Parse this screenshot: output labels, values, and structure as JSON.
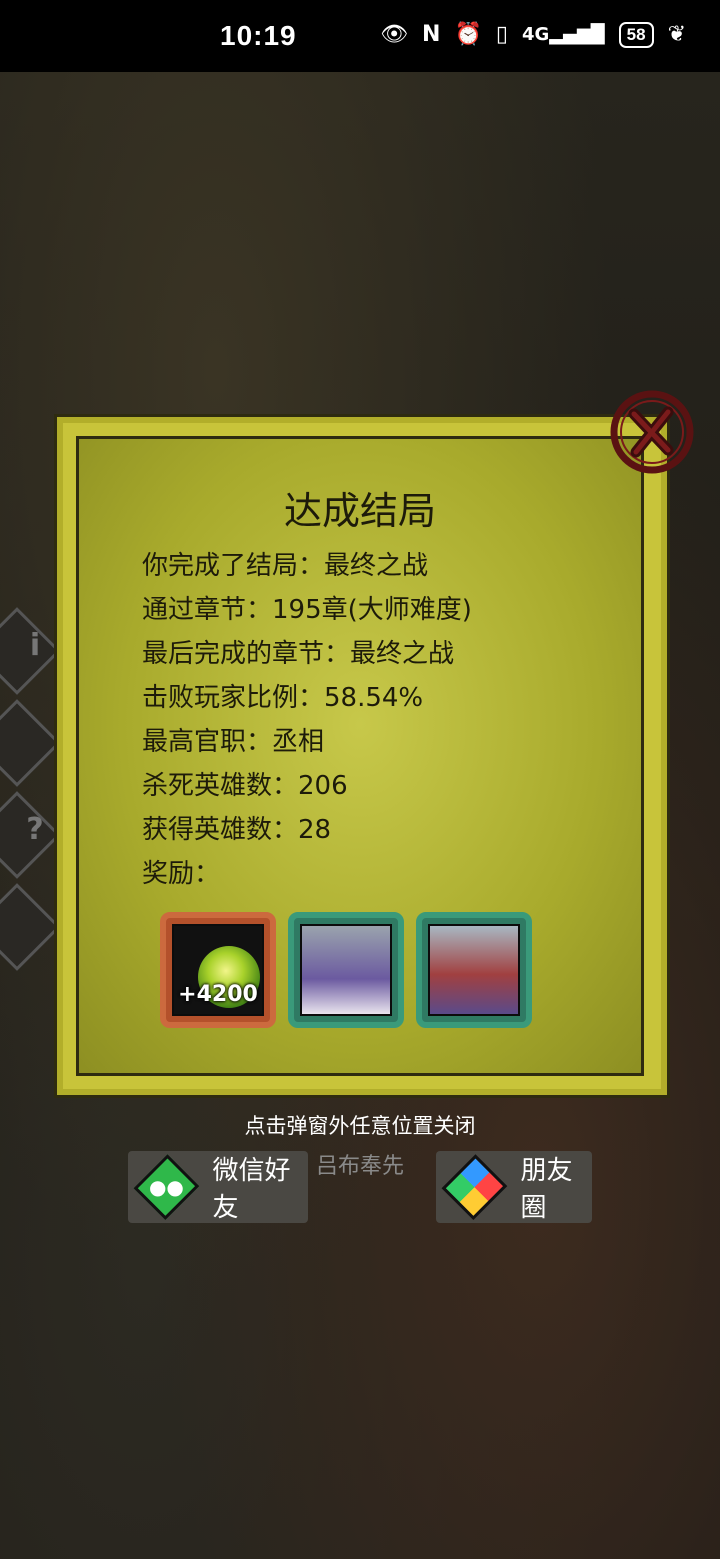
{
  "status_bar": {
    "time": "10:19",
    "battery": "58",
    "icons": [
      "eye-icon",
      "nfc-icon",
      "alarm-icon",
      "vibrate-icon",
      "signal-4g-icon",
      "battery-icon",
      "leaf-icon"
    ]
  },
  "modal": {
    "title": "达成结局",
    "lines": [
      "你完成了结局：最终之战",
      "通过章节：195章(大师难度)",
      "最后完成的章节：最终之战",
      "击败玩家比例：58.54%",
      "最高官职：丞相",
      "杀死英雄数：206",
      "获得英雄数：28"
    ],
    "reward_label": "奖励：",
    "rewards": [
      {
        "type": "currency",
        "amount": "+4200",
        "icon": "jade-orb-icon"
      },
      {
        "type": "hero",
        "icon": "hero-portrait-icon"
      },
      {
        "type": "hero",
        "icon": "archer-portrait-icon"
      }
    ],
    "close_icon": "close-icon"
  },
  "footer": {
    "hint": "点击弹窗外任意位置关闭",
    "background_name": "吕布奉先",
    "share_wechat": "微信好友",
    "share_moments": "朋友圈"
  }
}
